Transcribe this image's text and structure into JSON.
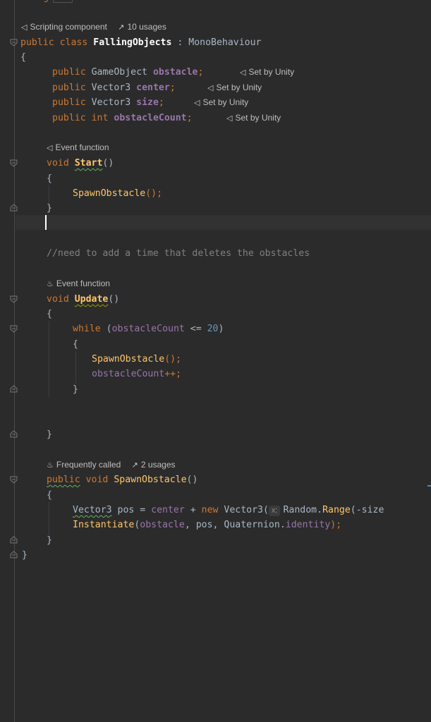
{
  "editor": {
    "top_partial": {
      "keyword": "using",
      "folded": "..."
    },
    "class_hint": {
      "label": "Scripting component",
      "usages": "10 usages"
    },
    "class_decl": {
      "public": "public",
      "class": "class",
      "name": "FallingObjects",
      "colon": ":",
      "base": "MonoBehaviour"
    },
    "open_brace": "{",
    "fields": [
      {
        "modifier": "public",
        "type": "GameObject",
        "name": "obstacle",
        "semi": ";",
        "hint": "Set by Unity"
      },
      {
        "modifier": "public",
        "type": "Vector3",
        "name": "center",
        "semi": ";",
        "hint": "Set by Unity"
      },
      {
        "modifier": "public",
        "type": "Vector3",
        "name": "size",
        "semi": ";",
        "hint": "Set by Unity"
      },
      {
        "modifier": "public",
        "type": "int",
        "name": "obstacleCount",
        "semi": ";",
        "hint": "Set by Unity"
      }
    ],
    "start": {
      "hint": "Event function",
      "void": "void",
      "name": "Start",
      "parens": "()",
      "open": "{",
      "call": "SpawnObstacle",
      "call_tail": "();",
      "close": "}"
    },
    "comment": "//need to add a time that deletes the obstacles",
    "update": {
      "hint": "Event function",
      "void": "void",
      "name": "Update",
      "parens": "()",
      "open": "{",
      "while": "while",
      "cond_open": "(",
      "cond_var": "obstacleCount",
      "cond_op": " <= ",
      "cond_num": "20",
      "cond_close": ")",
      "inner_open": "{",
      "call": "SpawnObstacle",
      "call_tail": "();",
      "incr_var": "obstacleCount",
      "incr_op": "++;",
      "inner_close": "}",
      "close": "}"
    },
    "spawn": {
      "hint": "Frequently called",
      "usages": "2 usages",
      "public": "public",
      "void": "void",
      "name": "SpawnObstacle",
      "parens": "()",
      "open": "{",
      "line1": {
        "type": "Vector3",
        "var": " pos = ",
        "center": "center",
        "plus": " + ",
        "new": "new",
        "ctor": " Vector3(",
        "inlay": "x:",
        "random": "Random",
        "dot": ".",
        "range": "Range",
        "tail": "(-size"
      },
      "line2": {
        "fn": "Instantiate",
        "open": "(",
        "a1": "obstacle",
        "c1": ", pos, ",
        "q": "Quaternion",
        "dot": ".",
        "ident": "identity",
        "end": ");"
      },
      "close": "}"
    },
    "class_close": "}"
  }
}
